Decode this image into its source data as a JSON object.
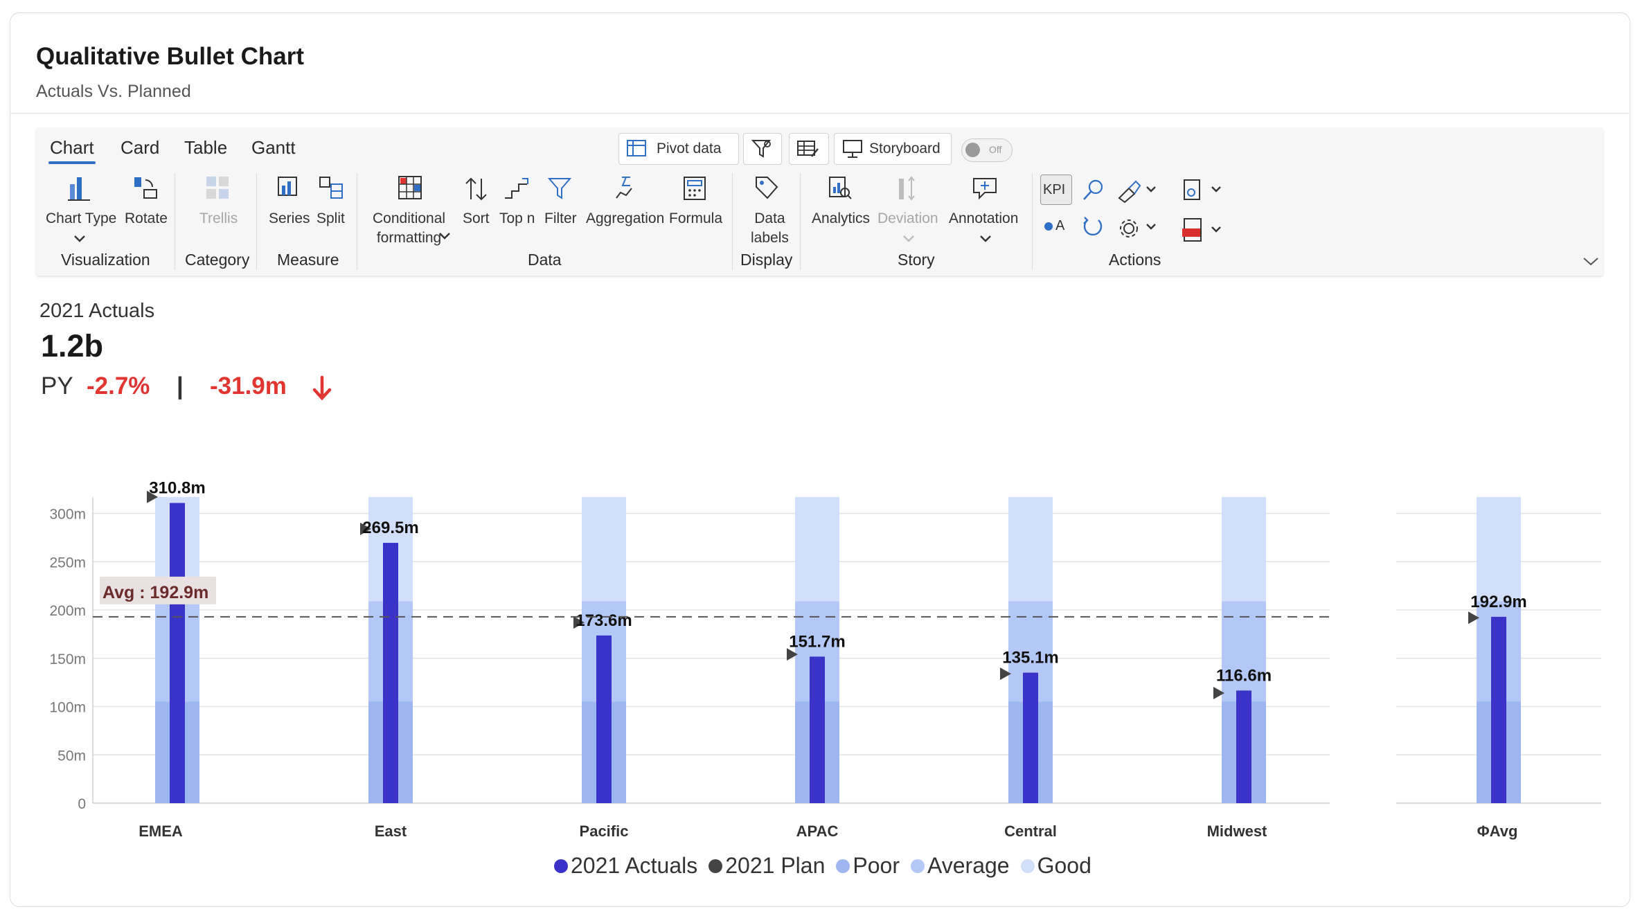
{
  "header": {
    "title": "Qualitative Bullet Chart",
    "subtitle": "Actuals Vs. Planned"
  },
  "ribbon": {
    "tabs": [
      "Chart",
      "Card",
      "Table",
      "Gantt"
    ],
    "top_buttons": {
      "pivot": "Pivot data",
      "storyboard": "Storyboard",
      "toggle": "Off"
    },
    "buttons": {
      "chart_type": "Chart Type",
      "rotate": "Rotate",
      "trellis": "Trellis",
      "series": "Series",
      "split": "Split",
      "conditional_1": "Conditional",
      "conditional_2": "formatting",
      "sort": "Sort",
      "topn": "Top n",
      "filter": "Filter",
      "aggregation": "Aggregation",
      "formula": "Formula",
      "data_labels_1": "Data",
      "data_labels_2": "labels",
      "analytics": "Analytics",
      "deviation": "Deviation",
      "annotation": "Annotation",
      "kpi": "KPI",
      "oa": "A"
    },
    "groups": {
      "visualization": "Visualization",
      "category": "Category",
      "measure": "Measure",
      "data": "Data",
      "display": "Display",
      "story": "Story",
      "actions": "Actions"
    }
  },
  "kpi": {
    "label": "2021 Actuals",
    "value": "1.2b",
    "py_label": "PY",
    "pct": "-2.7%",
    "sep": "|",
    "diff": "-31.9m"
  },
  "colors": {
    "actual": "#3b33c8",
    "plan": "#444444",
    "poor": "#9db6f2",
    "average": "#b3c8f6",
    "good": "#d2dffa",
    "negative": "#e03530"
  },
  "chart_data": {
    "type": "bar",
    "categories": [
      "EMEA",
      "East",
      "Pacific",
      "APAC",
      "Central",
      "Midwest"
    ],
    "series": [
      {
        "name": "2021 Actuals",
        "values": [
          310.8,
          269.5,
          173.6,
          151.7,
          135.1,
          116.6
        ]
      },
      {
        "name": "2021 Plan",
        "values": [
          317,
          284,
          187,
          154,
          134,
          114
        ]
      }
    ],
    "bands": {
      "Poor": 105,
      "Average": 209,
      "Good": 317
    },
    "data_labels": [
      "310.8m",
      "269.5m",
      "173.6m",
      "151.7m",
      "135.1m",
      "116.6m"
    ],
    "average": {
      "category": "ΦAvg",
      "value": 192.9,
      "data_label": "192.9m",
      "line_label": "Avg : 192.9m"
    },
    "y_ticks": [
      "0",
      "50m",
      "100m",
      "150m",
      "200m",
      "250m",
      "300m"
    ],
    "y_tick_values": [
      0,
      50,
      100,
      150,
      200,
      250,
      300
    ],
    "ylim": [
      0,
      317
    ],
    "legend": [
      "2021 Actuals",
      "2021 Plan",
      "Poor",
      "Average",
      "Good"
    ],
    "legend_position": "bottom"
  }
}
